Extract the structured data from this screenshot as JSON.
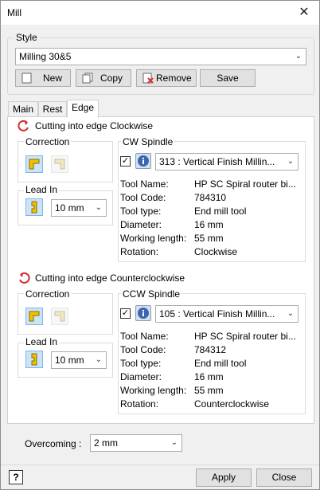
{
  "window": {
    "title": "Mill"
  },
  "style": {
    "label": "Style",
    "selected": "Milling 30&5",
    "buttons": {
      "new": "New",
      "copy": "Copy",
      "remove": "Remove",
      "save": "Save"
    }
  },
  "tabs": [
    {
      "label": "Main"
    },
    {
      "label": "Rest"
    },
    {
      "label": "Edge",
      "active": true
    }
  ],
  "cw": {
    "header": "Cutting into edge Clockwise",
    "correction_label": "Correction",
    "lead_in_label": "Lead In",
    "lead_in_value": "10 mm",
    "spindle_label": "CW Spindle",
    "tool_selected": "313 : Vertical Finish Millin...",
    "checked": true,
    "details": [
      {
        "key": "Tool Name:",
        "value": "HP SC Spiral router bi..."
      },
      {
        "key": "Tool Code:",
        "value": "784310"
      },
      {
        "key": "Tool type:",
        "value": "End mill tool"
      },
      {
        "key": "Diameter:",
        "value": "16 mm"
      },
      {
        "key": "Working length:",
        "value": "55 mm"
      },
      {
        "key": "Rotation:",
        "value": "Clockwise"
      }
    ]
  },
  "ccw": {
    "header": "Cutting into edge Counterclockwise",
    "correction_label": "Correction",
    "lead_in_label": "Lead In",
    "lead_in_value": "10 mm",
    "spindle_label": "CCW Spindle",
    "tool_selected": "105 : Vertical Finish Millin...",
    "checked": true,
    "details": [
      {
        "key": "Tool Name:",
        "value": "HP SC Spiral router bi..."
      },
      {
        "key": "Tool Code:",
        "value": "784312"
      },
      {
        "key": "Tool type:",
        "value": "End mill tool"
      },
      {
        "key": "Diameter:",
        "value": "16 mm"
      },
      {
        "key": "Working length:",
        "value": "55 mm"
      },
      {
        "key": "Rotation:",
        "value": "Counterclockwise"
      }
    ]
  },
  "overcoming": {
    "label": "Overcoming :",
    "value": "2 mm"
  },
  "footer": {
    "help": "?",
    "apply": "Apply",
    "close": "Close"
  },
  "colors": {
    "accent": "#cce4f7",
    "arrow_red": "#d32f2f",
    "icon_yellow": "#f2c200"
  }
}
